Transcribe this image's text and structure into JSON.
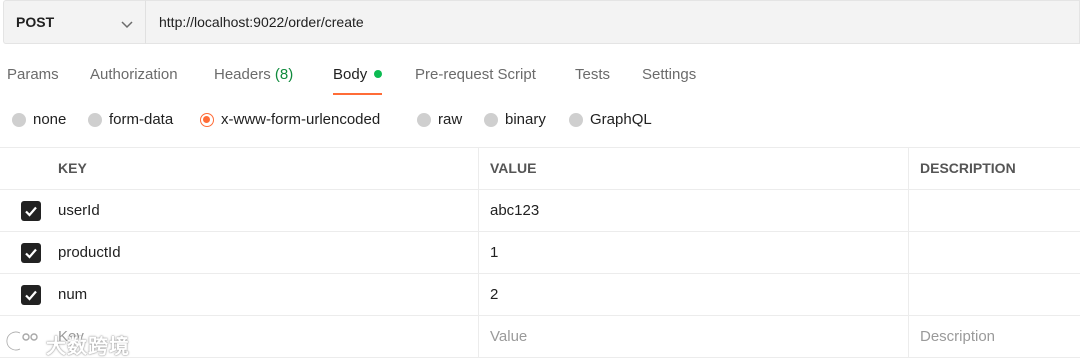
{
  "request": {
    "method": "POST",
    "url": "http://localhost:9022/order/create"
  },
  "tabs": [
    {
      "label": "Params"
    },
    {
      "label": "Authorization"
    },
    {
      "label": "Headers",
      "count": "(8)"
    },
    {
      "label": "Body",
      "active": true
    },
    {
      "label": "Pre-request Script"
    },
    {
      "label": "Tests"
    },
    {
      "label": "Settings"
    }
  ],
  "body_types": [
    {
      "label": "none"
    },
    {
      "label": "form-data"
    },
    {
      "label": "x-www-form-urlencoded",
      "selected": true
    },
    {
      "label": "raw"
    },
    {
      "label": "binary"
    },
    {
      "label": "GraphQL"
    }
  ],
  "table": {
    "headers": {
      "key": "KEY",
      "value": "VALUE",
      "description": "DESCRIPTION"
    },
    "rows": [
      {
        "key": "userId",
        "value": "abc123",
        "description": "",
        "checked": true
      },
      {
        "key": "productId",
        "value": "1",
        "description": "",
        "checked": true
      },
      {
        "key": "num",
        "value": "2",
        "description": "",
        "checked": true
      }
    ],
    "placeholders": {
      "key": "Key",
      "value": "Value",
      "description": "Description"
    }
  },
  "watermark": {
    "text": "大数跨境"
  },
  "colors": {
    "accent": "#ff6c37",
    "active_dot": "#0cbb52",
    "count": "#0f8a3c"
  }
}
